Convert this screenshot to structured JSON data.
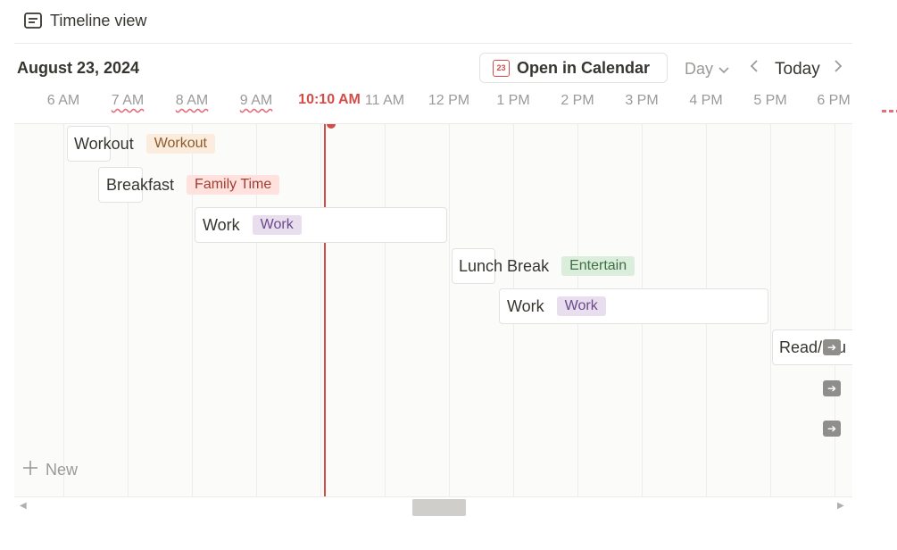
{
  "view": {
    "title": "Timeline view",
    "icon": "table-view-icon"
  },
  "toolbar": {
    "date": "August 23, 2024",
    "open_calendar": "Open in Calendar",
    "calendar_icon_day": "23",
    "day_select": "Day",
    "today": "Today"
  },
  "timeline": {
    "hours": [
      "6 AM",
      "7 AM",
      "8 AM",
      "9 AM",
      "10 AM",
      "11 AM",
      "12 PM",
      "1 PM",
      "2 PM",
      "3 PM",
      "4 PM",
      "5 PM",
      "6 PM"
    ],
    "now_label": "10:10 AM",
    "events": [
      {
        "title": "Workout",
        "tag": "Workout"
      },
      {
        "title": "Breakfast",
        "tag": "Family Time"
      },
      {
        "title": "Work",
        "tag": "Work"
      },
      {
        "title": "Lunch Break",
        "tag": "Entertain"
      },
      {
        "title": "Work",
        "tag": "Work"
      },
      {
        "title": "Read/Stu"
      }
    ],
    "new_label": "New"
  },
  "colors": {
    "accent_red": "#d44c47",
    "tag_workout_bg": "#fbecdd",
    "tag_family_bg": "#ffe2dd",
    "tag_work_bg": "#e8deee",
    "tag_entertain_bg": "#dbeddb"
  }
}
